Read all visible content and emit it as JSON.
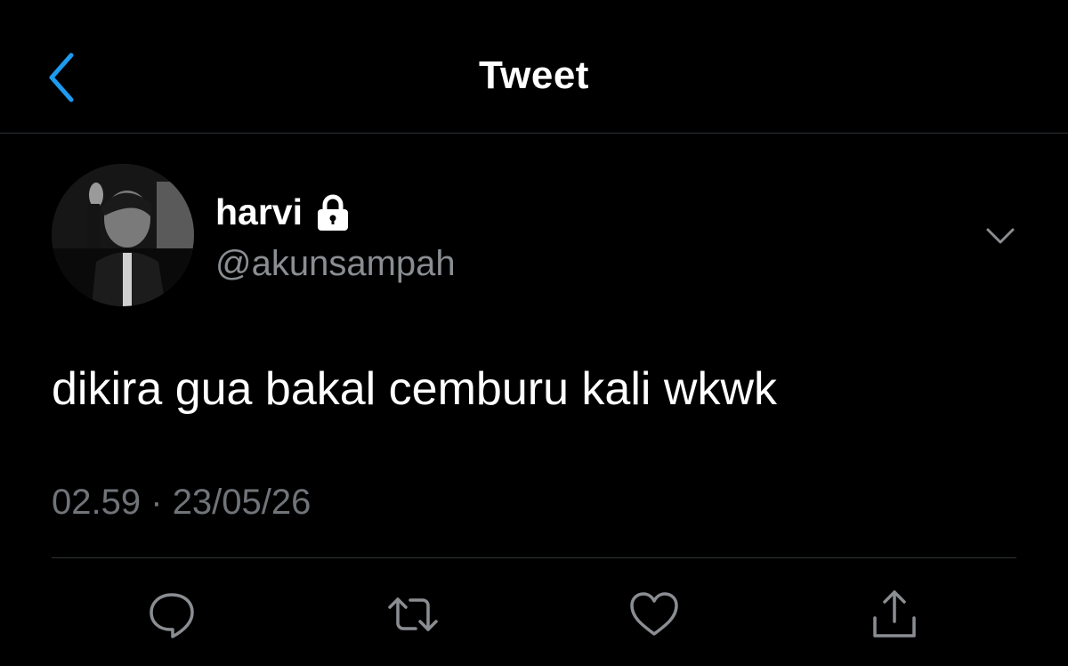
{
  "header": {
    "title": "Tweet",
    "back_icon": "chevron-left-icon",
    "accent_color": "#1d9bf0"
  },
  "author": {
    "display_name": "harvi",
    "handle": "@akunsampah",
    "protected_icon": "lock-icon"
  },
  "tweet": {
    "text": "dikira gua bakal cemburu kali wkwk",
    "time": "02.59",
    "separator": "·",
    "date": "23/05/26"
  },
  "actions": {
    "items": [
      "reply-icon",
      "retweet-icon",
      "like-icon",
      "share-icon"
    ]
  },
  "colors": {
    "background": "#000000",
    "primary_text": "#ffffff",
    "secondary_text": "#8a8d91",
    "divider": "#2f3336"
  }
}
